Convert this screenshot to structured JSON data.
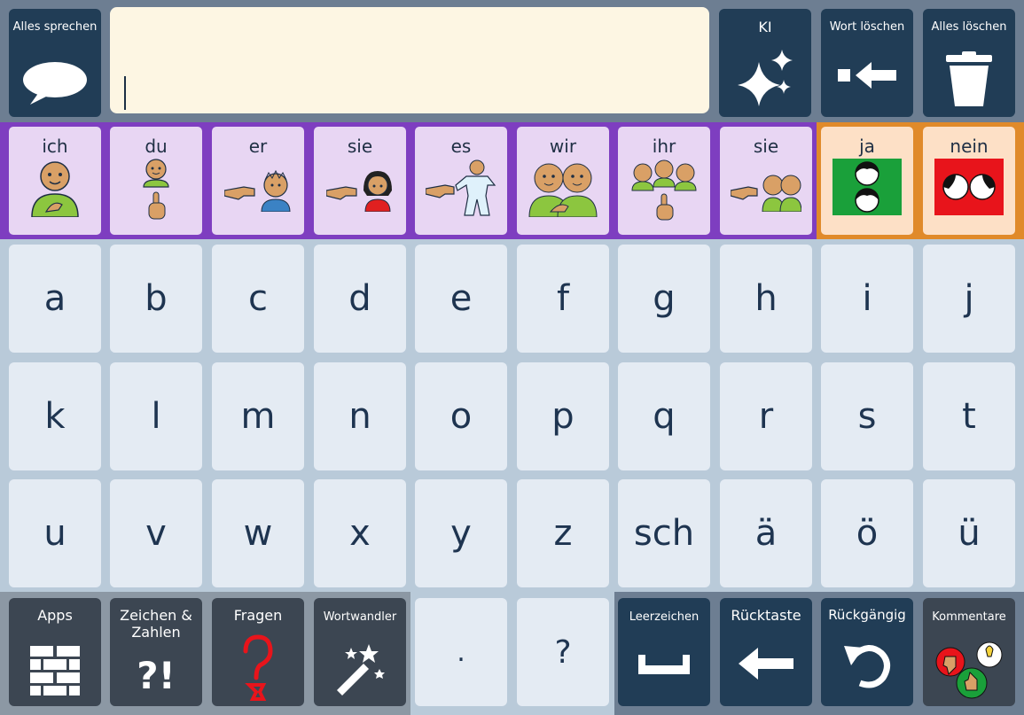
{
  "top_bar": {
    "speak_all_label": "Alles sprechen",
    "ai_label": "KI",
    "delete_word_label": "Wort löschen",
    "delete_all_label": "Alles löschen",
    "message_text": ""
  },
  "pronouns": [
    "ich",
    "du",
    "er",
    "sie",
    "es",
    "wir",
    "ihr",
    "sie"
  ],
  "answers": {
    "yes": "ja",
    "no": "nein"
  },
  "keys": {
    "row1": [
      "a",
      "b",
      "c",
      "d",
      "e",
      "f",
      "g",
      "h",
      "i",
      "j"
    ],
    "row2": [
      "k",
      "l",
      "m",
      "n",
      "o",
      "p",
      "q",
      "r",
      "s",
      "t"
    ],
    "row3": [
      "u",
      "v",
      "w",
      "x",
      "y",
      "z",
      "sch",
      "ä",
      "ö",
      "ü"
    ]
  },
  "bottom_bar": {
    "apps_label": "Apps",
    "symbols_label": "Zeichen &\nZahlen",
    "symbols_icon_text": "?!",
    "questions_label": "Fragen",
    "word_changer_label": "Wortwandler",
    "period_label": ".",
    "question_mark_label": "?",
    "space_label": "Leerzeichen",
    "backspace_label": "Rücktaste",
    "undo_label": "Rückgängig",
    "comments_label": "Kommentare"
  },
  "colors": {
    "dark_button": "#213d56",
    "gray_button": "#3c4652",
    "pronoun_band": "#7e3ec0",
    "answer_band": "#e08a2a",
    "key_bg": "#e4ebf3",
    "message_bg": "#fdf6e3",
    "yes_green": "#1aa03a",
    "no_red": "#e8141b"
  }
}
